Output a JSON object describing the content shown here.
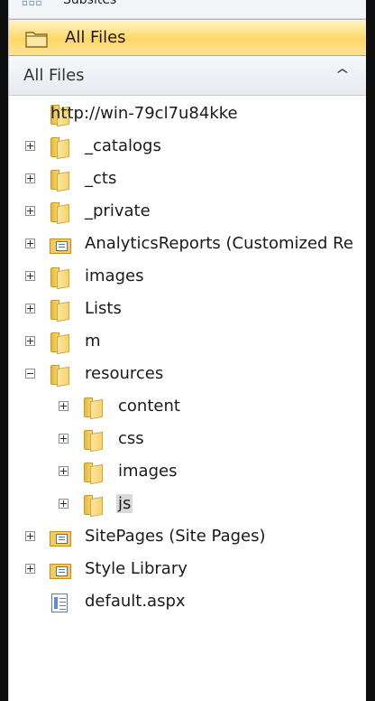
{
  "nav": {
    "partial_label": "Subsites",
    "selected_label": "All Files"
  },
  "panel": {
    "title": "All Files",
    "collapse_icon": "chevron-up-icon"
  },
  "tree": [
    {
      "label": "http://win-79cl7u84kke",
      "icon": "folder",
      "toggle": "none",
      "level": 0
    },
    {
      "label": "_catalogs",
      "icon": "folder",
      "toggle": "plus",
      "level": 0
    },
    {
      "label": "_cts",
      "icon": "folder",
      "toggle": "plus",
      "level": 0
    },
    {
      "label": "_private",
      "icon": "folder",
      "toggle": "plus",
      "level": 0
    },
    {
      "label": "AnalyticsReports (Customized Re",
      "icon": "library",
      "toggle": "plus",
      "level": 0
    },
    {
      "label": "images",
      "icon": "folder",
      "toggle": "plus",
      "level": 0
    },
    {
      "label": "Lists",
      "icon": "folder",
      "toggle": "plus",
      "level": 0
    },
    {
      "label": "m",
      "icon": "folder",
      "toggle": "plus",
      "level": 0
    },
    {
      "label": "resources",
      "icon": "folder",
      "toggle": "minus",
      "level": 0
    },
    {
      "label": "content",
      "icon": "folder",
      "toggle": "plus",
      "level": 1
    },
    {
      "label": "css",
      "icon": "folder",
      "toggle": "plus",
      "level": 1
    },
    {
      "label": "images",
      "icon": "folder",
      "toggle": "plus",
      "level": 1
    },
    {
      "label": "js",
      "icon": "folder",
      "toggle": "plus",
      "level": 1,
      "selected": true
    },
    {
      "label": "SitePages (Site Pages)",
      "icon": "library",
      "toggle": "plus",
      "level": 0
    },
    {
      "label": "Style Library",
      "icon": "library",
      "toggle": "plus",
      "level": 0
    },
    {
      "label": "default.aspx",
      "icon": "page",
      "toggle": "none",
      "level": 0
    }
  ]
}
